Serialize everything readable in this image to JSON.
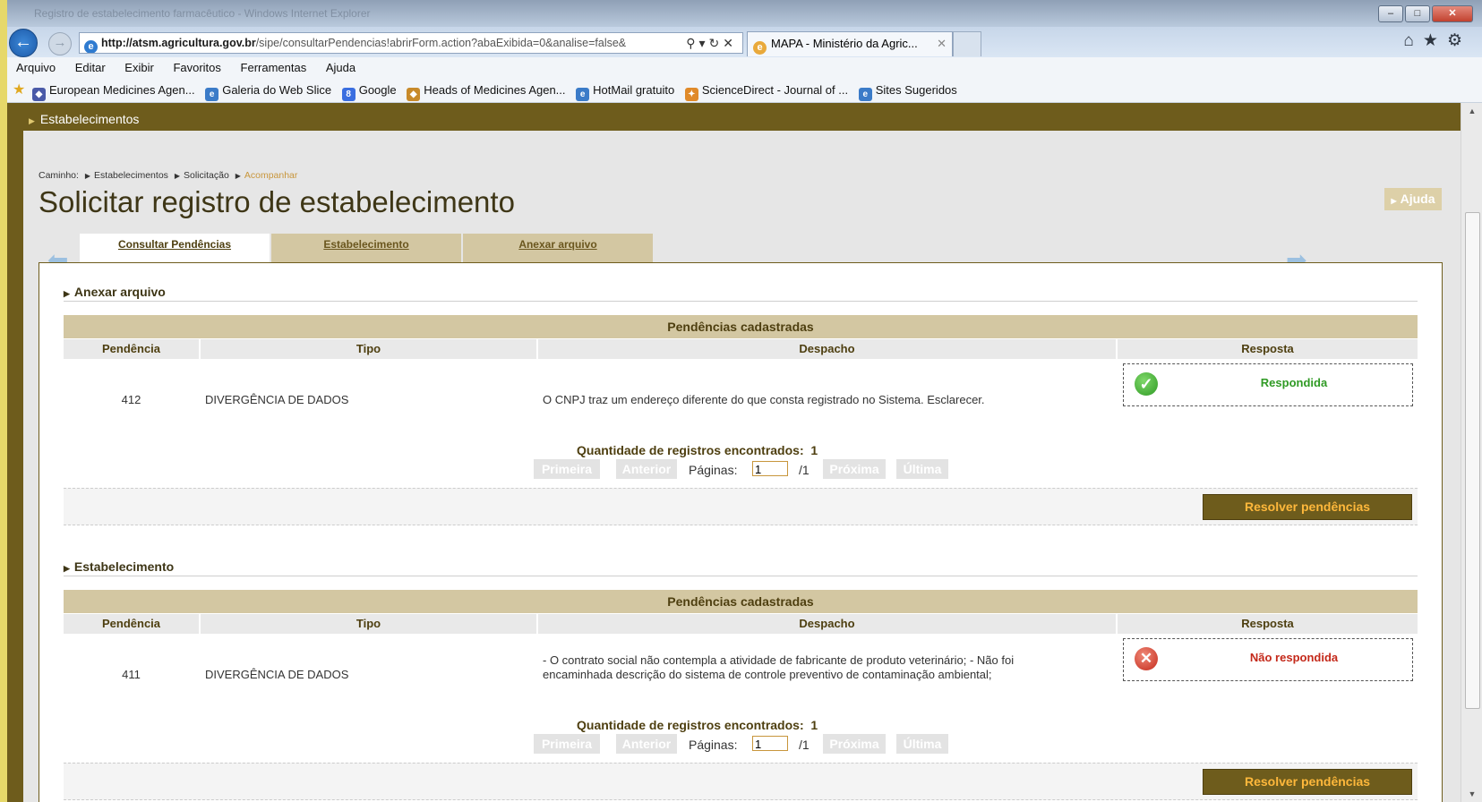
{
  "browser": {
    "window_title": "Registro de estabelecimento farmacêutico - Windows Internet Explorer",
    "url_host": "http://atsm.agricultura.gov.br",
    "url_path": "/sipe/consultarPendencias!abrirForm.action?abaExibida=0&analise=false&",
    "tab_title": "MAPA - Ministério da Agric...",
    "menu": [
      "Arquivo",
      "Editar",
      "Exibir",
      "Favoritos",
      "Ferramentas",
      "Ajuda"
    ],
    "favorites": [
      "European Medicines Agen...",
      "Galeria do Web Slice",
      "Google",
      "Heads of Medicines Agen...",
      "HotMail gratuito",
      "ScienceDirect - Journal of ...",
      "Sites Sugeridos"
    ]
  },
  "page": {
    "banner": "Estabelecimentos",
    "breadcrumb": {
      "label": "Caminho:",
      "items": [
        "Estabelecimentos",
        "Solicitação"
      ],
      "current": "Acompanhar"
    },
    "title": "Solicitar registro de estabelecimento",
    "help": "Ajuda",
    "tabs": [
      "Consultar Pendências",
      "Estabelecimento",
      "Anexar arquivo"
    ]
  },
  "columns": [
    "Pendência",
    "Tipo",
    "Despacho",
    "Resposta"
  ],
  "sections": [
    {
      "title": "Anexar arquivo",
      "grid_title": "Pendências cadastradas",
      "row": {
        "pendencia": "412",
        "tipo": "DIVERGÊNCIA DE DADOS",
        "despacho": "O CNPJ traz um endereço diferente do que consta registrado no Sistema. Esclarecer.",
        "resposta": "Respondida"
      },
      "count_label": "Quantidade de registros encontrados:",
      "count": "1",
      "pager": {
        "first": "Primeira",
        "prev": "Anterior",
        "pages_label": "Páginas:",
        "page": "1",
        "total": "/1",
        "next": "Próxima",
        "last": "Última"
      },
      "action": "Resolver pendências"
    },
    {
      "title": "Estabelecimento",
      "grid_title": "Pendências cadastradas",
      "row": {
        "pendencia": "411",
        "tipo": "DIVERGÊNCIA DE DADOS",
        "despacho_1": "- O contrato social não contempla a atividade de fabricante de produto veterinário; - Não foi",
        "despacho_2": "encaminhada descrição do sistema de controle preventivo de contaminação ambiental;",
        "resposta": "Não respondida"
      },
      "count_label": "Quantidade de registros encontrados:",
      "count": "1",
      "pager": {
        "first": "Primeira",
        "prev": "Anterior",
        "pages_label": "Páginas:",
        "page": "1",
        "total": "/1",
        "next": "Próxima",
        "last": "Última"
      },
      "action": "Resolver pendências"
    }
  ],
  "colors": {
    "brand_dark": "#6e5c1c",
    "tab_bg": "#d3c7a2",
    "ok": "#2f9a24",
    "bad": "#c4291a",
    "action_text": "#ffb83b"
  }
}
